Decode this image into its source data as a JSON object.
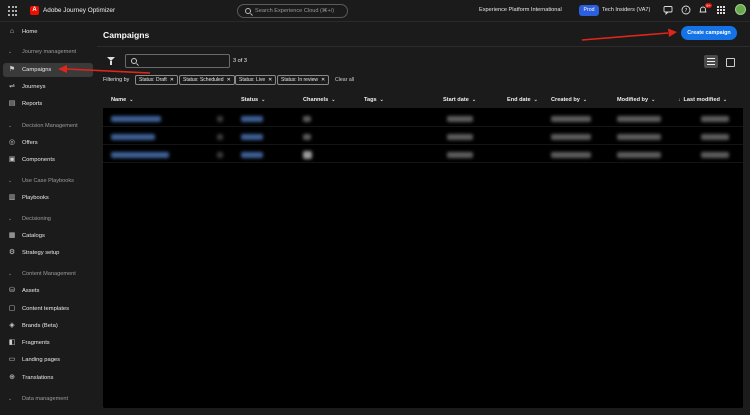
{
  "topbar": {
    "app_name": "Adobe Journey Optimizer",
    "logo_letter": "A",
    "search_placeholder": "Search Experience Cloud (⌘+/)",
    "org_name": "Experience Platform International",
    "env_badge": "Prod",
    "sandbox_name": "Tech Insiders (VA7)",
    "notification_count": "9+",
    "icons": [
      "apps-grid-icon",
      "search-icon",
      "feedback-icon",
      "help-icon",
      "bell-icon",
      "apps-icon",
      "avatar"
    ]
  },
  "sidebar": {
    "home": "Home",
    "sections": {
      "journey_management": "Journey management",
      "decision_management": "Decision Management",
      "use_case_playbooks": "Use Case Playbooks",
      "decisioning": "Decisioning",
      "content_management": "Content Management",
      "data_management": "Data management"
    },
    "items": {
      "campaigns": "Campaigns",
      "journeys": "Journeys",
      "reports": "Reports",
      "offers": "Offers",
      "components": "Components",
      "playbooks": "Playbooks",
      "catalogs": "Catalogs",
      "strategy_setup": "Strategy setup",
      "assets": "Assets",
      "content_templates": "Content templates",
      "brands": "Brands (Beta)",
      "fragments": "Fragments",
      "landing_pages": "Landing pages",
      "translations": "Translations"
    }
  },
  "main": {
    "title": "Campaigns",
    "create_button": "Create campaign",
    "result_count": "3 of 3",
    "filtering_by": "Filtering by",
    "filters": [
      "Status: Draft",
      "Status: Scheduled",
      "Status: Live",
      "Status: In review"
    ],
    "clear_all": "Clear all",
    "columns": {
      "name": "Name",
      "status": "Status",
      "channels": "Channels",
      "tags": "Tags",
      "start_date": "Start date",
      "end_date": "End date",
      "created_by": "Created by",
      "modified_by": "Modified by",
      "last_modified": "Last modified"
    },
    "sort_column": "Last modified",
    "row_count": 3,
    "rows_blurred": true
  },
  "annotations": {
    "arrow_color": "#e0261a",
    "targets": [
      "sidebar-item-campaigns",
      "create-campaign-button"
    ]
  }
}
